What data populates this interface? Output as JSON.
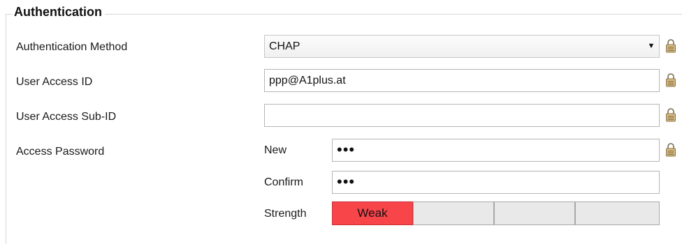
{
  "section": {
    "title": "Authentication"
  },
  "fields": {
    "auth_method": {
      "label": "Authentication Method",
      "value": "CHAP"
    },
    "user_access_id": {
      "label": "User Access ID",
      "value": "ppp@A1plus.at"
    },
    "user_access_sub_id": {
      "label": "User Access Sub-ID",
      "value": ""
    },
    "access_password": {
      "label": "Access Password",
      "new_label": "New",
      "new_value": "•••",
      "confirm_label": "Confirm",
      "confirm_value": "•••",
      "strength_label": "Strength",
      "strength_levels": [
        "Weak",
        "",
        "",
        ""
      ],
      "strength_active_count": 1
    }
  },
  "colors": {
    "strength_active": "#f7454a",
    "strength_inactive": "#e9e9e9",
    "lock_icon": "#b89a62"
  },
  "icons": {
    "field_lock": "padlock-icon",
    "dropdown": "chevron-down-icon"
  }
}
